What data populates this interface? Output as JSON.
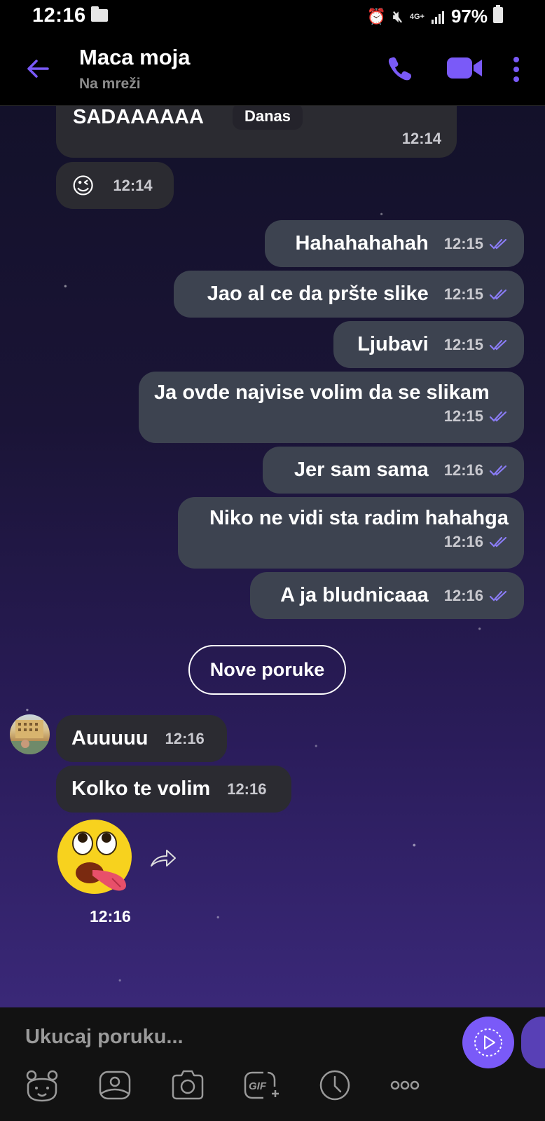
{
  "status_bar": {
    "time": "12:16",
    "network": "4G+",
    "battery": "97%"
  },
  "header": {
    "name": "Maca moja",
    "status": "Na mreži"
  },
  "date_chip": "Danas",
  "messages": [
    {
      "dir": "in",
      "text": "SADAAAAAA",
      "time": "12:14"
    },
    {
      "dir": "in",
      "text": "😉",
      "time": "12:14"
    },
    {
      "dir": "out",
      "text": "Hahahahahah",
      "time": "12:15"
    },
    {
      "dir": "out",
      "text": "Jao al ce da pršte slike",
      "time": "12:15"
    },
    {
      "dir": "out",
      "text": "Ljubavi",
      "time": "12:15"
    },
    {
      "dir": "out",
      "text": "Ja ovde najvise volim da se slikam",
      "time": "12:15"
    },
    {
      "dir": "out",
      "text": "Jer sam sama",
      "time": "12:16"
    },
    {
      "dir": "out",
      "text": "Niko ne vidi sta radim hahahga",
      "time": "12:16"
    },
    {
      "dir": "out",
      "text": "A ja bludnicaaa",
      "time": "12:16"
    },
    {
      "dir": "in",
      "text": "Auuuuu",
      "time": "12:16"
    },
    {
      "dir": "in",
      "text": "Kolko te volim",
      "time": "12:16"
    },
    {
      "dir": "in",
      "sticker": "drooling-face",
      "time": "12:16"
    }
  ],
  "new_messages_label": "Nove poruke",
  "composer": {
    "placeholder": "Ukucaj poruku...",
    "tools": [
      "sticker-icon",
      "gallery-icon",
      "camera-icon",
      "gif-icon",
      "timer-icon",
      "more-icon"
    ]
  },
  "colors": {
    "accent": "#7a5af8",
    "bubble_out": "#3d4350",
    "bubble_in": "#2b2b31",
    "read_checks": "#8a7cf5"
  }
}
